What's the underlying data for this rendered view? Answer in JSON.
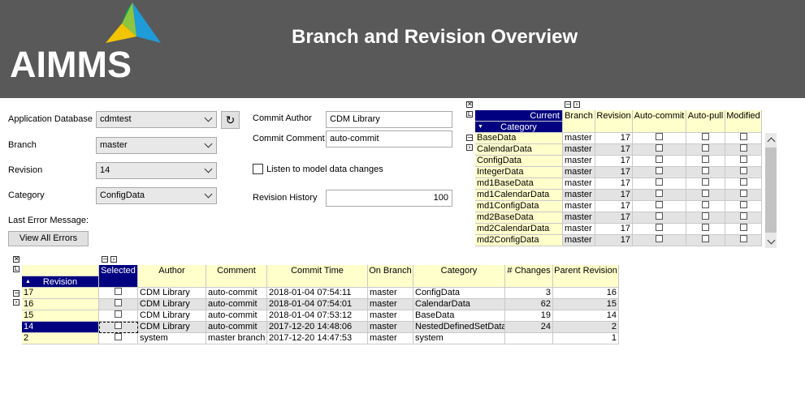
{
  "header": {
    "title": "Branch and Revision Overview",
    "logo_text": "AIMMS"
  },
  "form": {
    "app_db_label": "Application Database",
    "app_db_value": "cdmtest",
    "branch_label": "Branch",
    "branch_value": "master",
    "revision_label": "Revision",
    "revision_value": "14",
    "category_label": "Category",
    "category_value": "ConfigData",
    "last_error_label": "Last Error Message:",
    "view_errors_label": "View All Errors",
    "commit_author_label": "Commit Author",
    "commit_author_value": "CDM Library",
    "commit_comment_label": "Commit Comment",
    "commit_comment_value": "auto-commit",
    "listen_label": "Listen to model data changes",
    "revision_history_label": "Revision History",
    "revision_history_value": "100"
  },
  "category_table": {
    "current_label": "Current",
    "category_label": "Category",
    "columns": [
      "Branch",
      "Revision",
      "Auto-commit",
      "Auto-pull",
      "Modified"
    ],
    "rows": [
      {
        "name": "BaseData",
        "branch": "master",
        "revision": "17"
      },
      {
        "name": "CalendarData",
        "branch": "master",
        "revision": "17"
      },
      {
        "name": "ConfigData",
        "branch": "master",
        "revision": "17"
      },
      {
        "name": "IntegerData",
        "branch": "master",
        "revision": "17"
      },
      {
        "name": "md1BaseData",
        "branch": "master",
        "revision": "17"
      },
      {
        "name": "md1CalendarData",
        "branch": "master",
        "revision": "17"
      },
      {
        "name": "md1ConfigData",
        "branch": "master",
        "revision": "17"
      },
      {
        "name": "md2BaseData",
        "branch": "master",
        "revision": "17"
      },
      {
        "name": "md2CalendarData",
        "branch": "master",
        "revision": "17"
      },
      {
        "name": "md2ConfigData",
        "branch": "master",
        "revision": "17"
      }
    ]
  },
  "revision_table": {
    "revision_label": "Revision",
    "columns": [
      "Selected",
      "Author",
      "Comment",
      "Commit Time",
      "On Branch",
      "Category",
      "# Changes",
      "Parent Revision"
    ],
    "rows": [
      {
        "rev": "17",
        "author": "CDM Library",
        "comment": "auto-commit",
        "time": "2018-01-04 07:54:11",
        "branch": "master",
        "category": "ConfigData",
        "changes": "3",
        "parent": "16"
      },
      {
        "rev": "16",
        "author": "CDM Library",
        "comment": "auto-commit",
        "time": "2018-01-04 07:54:01",
        "branch": "master",
        "category": "CalendarData",
        "changes": "62",
        "parent": "15"
      },
      {
        "rev": "15",
        "author": "CDM Library",
        "comment": "auto-commit",
        "time": "2018-01-04 07:53:12",
        "branch": "master",
        "category": "BaseData",
        "changes": "19",
        "parent": "14"
      },
      {
        "rev": "14",
        "author": "CDM Library",
        "comment": "auto-commit",
        "time": "2017-12-20 14:48:06",
        "branch": "master",
        "category": "NestedDefinedSetData",
        "changes": "24",
        "parent": "2"
      },
      {
        "rev": "2",
        "author": "system",
        "comment": "master branch",
        "time": "2017-12-20 14:47:53",
        "branch": "master",
        "category": "system",
        "changes": "",
        "parent": "1"
      }
    ]
  },
  "colors": {
    "header_bg": "#595959",
    "selection": "#000080",
    "label_bg": "#ffffcc",
    "alt_row": "#e3e3e3"
  }
}
